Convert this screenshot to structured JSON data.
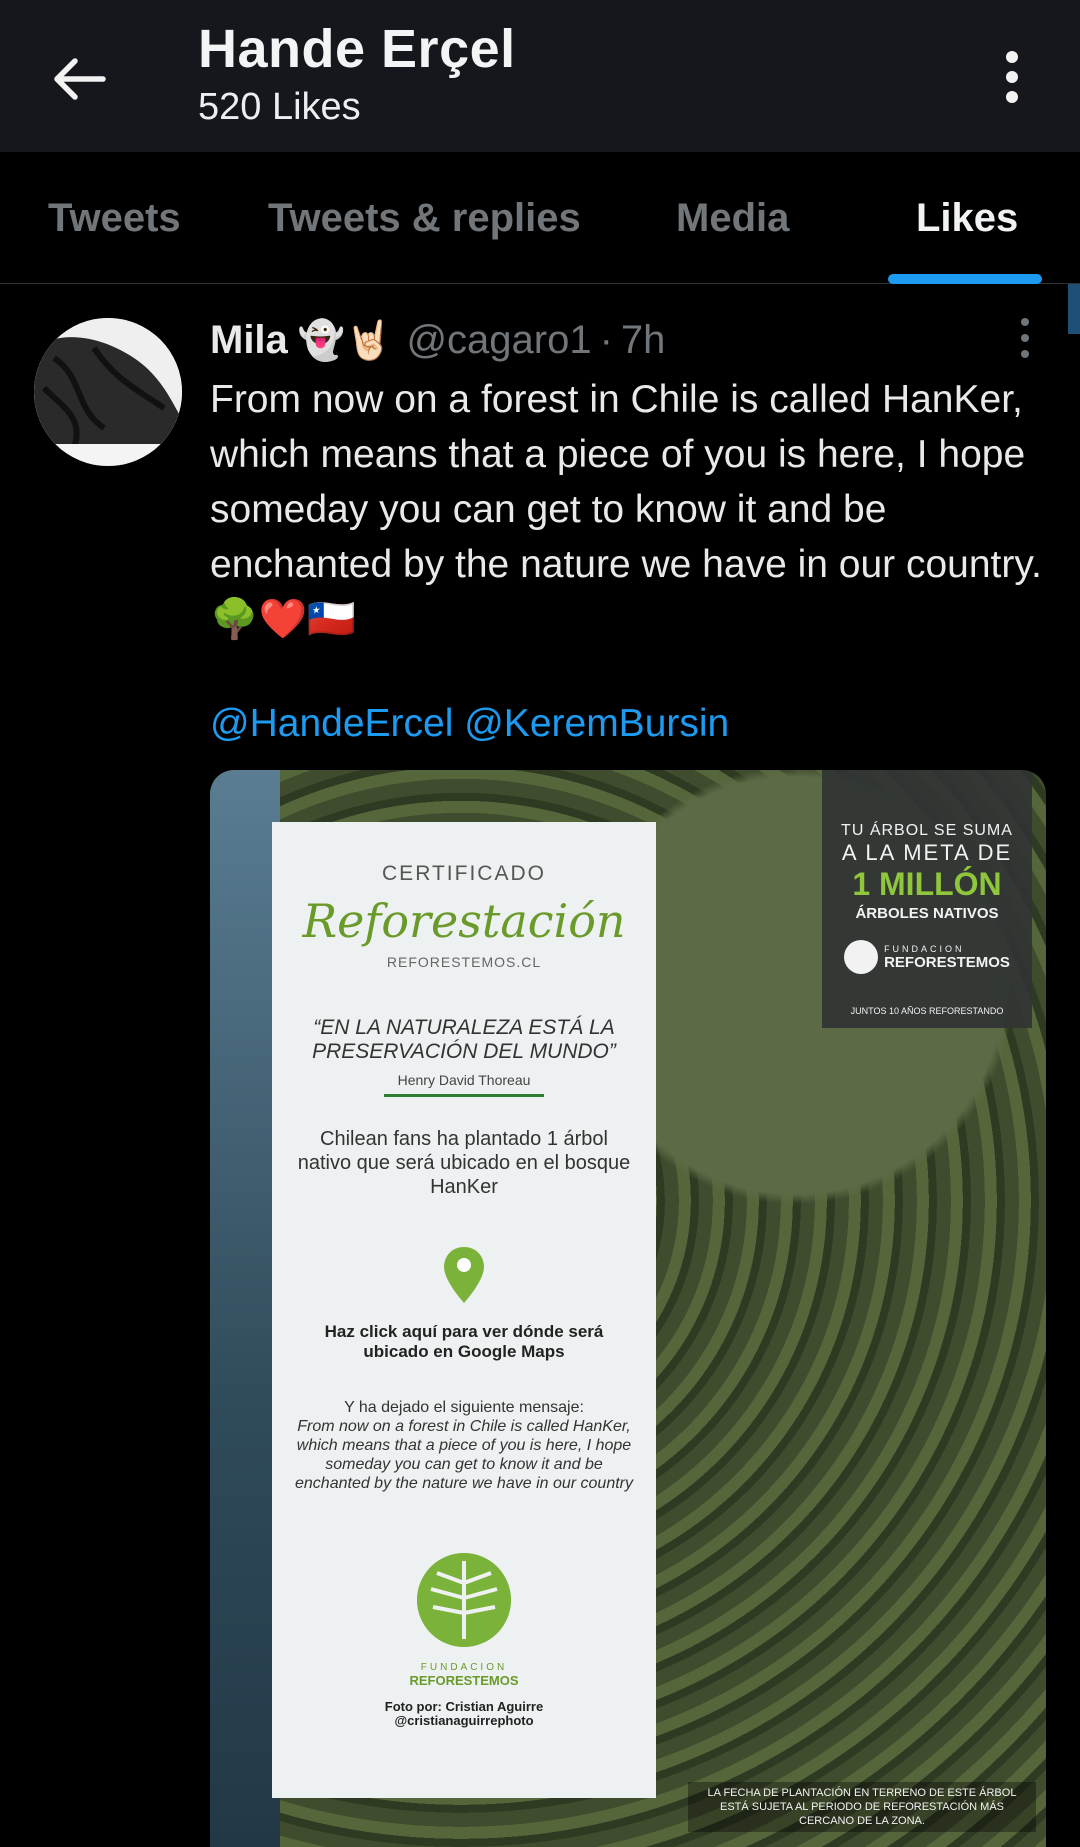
{
  "header": {
    "title": "Hande Erçel",
    "subtitle": "520 Likes"
  },
  "tabs": [
    {
      "label": "Tweets",
      "active": false
    },
    {
      "label": "Tweets & replies",
      "active": false
    },
    {
      "label": "Media",
      "active": false
    },
    {
      "label": "Likes",
      "active": true
    }
  ],
  "tweet": {
    "name": "Mila",
    "emojis": "👻🤘🏻",
    "handle": "@cagaro1",
    "separator": "·",
    "time": "7h",
    "text": "From now on a forest in Chile is called HanKer, which means that a piece of you is here, I hope someday you can get to know it and be enchanted by the nature we have in our country.🌳❤️🇨🇱",
    "mentions": [
      "@HandeErcel",
      "@KeremBursin"
    ],
    "image": {
      "certificate": {
        "heading": "CERTIFICADO",
        "script": "Reforestación",
        "site": "REFORESTEMOS.CL",
        "quote": "“EN LA NATURALEZA ESTÁ LA PRESERVACIÓN DEL MUNDO”",
        "author": "Henry David Thoreau",
        "body": "Chilean fans ha plantado 1 árbol nativo que será ubicado en el bosque HanKer",
        "click": "Haz click aquí para ver dónde será ubicado en Google Maps",
        "msg_intro": "Y ha dejado el siguiente mensaje:",
        "msg": "From now on a forest in Chile is called HanKer, which means that a piece of you is here, I hope someday you can get to know it and be enchanted by the nature we have in our country",
        "fund_top": "FUNDACION",
        "fund_name": "REFORESTEMOS",
        "photo_credit": "Foto por: Cristian Aguirre",
        "photo_handle": "@cristianaguirrephoto"
      },
      "badge": {
        "line1": "TU ÁRBOL SE SUMA",
        "line2": "A LA META DE",
        "line3": "1 MILLÓN",
        "line4": "ÁRBOLES NATIVOS",
        "fund_top": "FUNDACION",
        "fund_name": "REFORESTEMOS",
        "line5": "JUNTOS 10 AÑOS REFORESTANDO"
      },
      "footnote": "LA FECHA DE PLANTACIÓN EN TERRENO DE ESTE ÁRBOL ESTÁ SUJETA AL PERIODO DE REFORESTACIÓN MÁS CERCANO DE LA ZONA."
    }
  },
  "icons": {
    "back": "arrow-left-icon",
    "more": "more-vertical-icon"
  },
  "colors": {
    "accent": "#1d9bf0",
    "header_bg": "#15171c",
    "muted": "#71767b"
  }
}
